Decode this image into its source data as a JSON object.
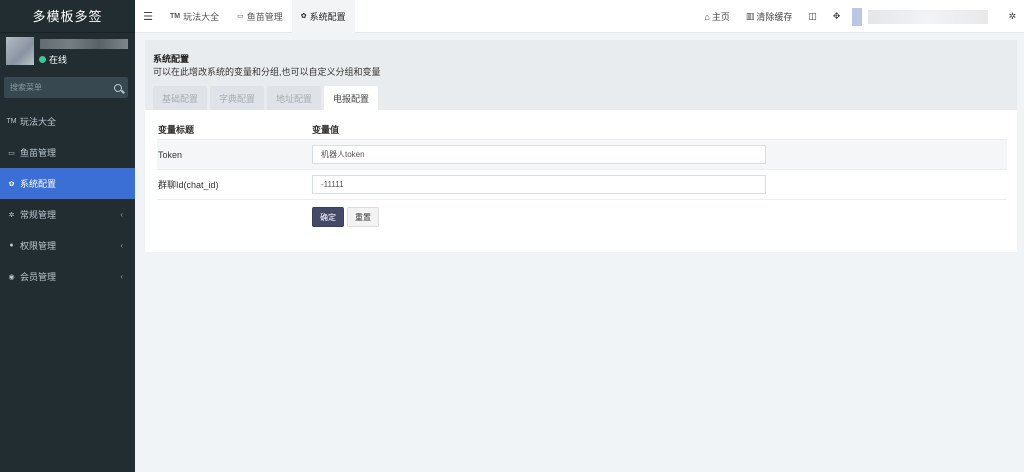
{
  "app": {
    "brand": "多模板多签"
  },
  "user": {
    "status": "在线"
  },
  "sidebar": {
    "search_placeholder": "搜索菜单",
    "items": [
      {
        "icon": "TM",
        "label": "玩法大全",
        "active": false,
        "has_children": false
      },
      {
        "icon": "gamepad",
        "label": "鱼苗管理",
        "active": false,
        "has_children": false
      },
      {
        "icon": "gear",
        "label": "系统配置",
        "active": true,
        "has_children": false
      },
      {
        "icon": "cogs",
        "label": "常规管理",
        "active": false,
        "has_children": true
      },
      {
        "icon": "users",
        "label": "权限管理",
        "active": false,
        "has_children": true
      },
      {
        "icon": "user-circle",
        "label": "会员管理",
        "active": false,
        "has_children": true
      }
    ]
  },
  "topnav": {
    "tabs": [
      {
        "icon": "TM",
        "label": "玩法大全",
        "active": false
      },
      {
        "icon": "gamepad",
        "label": "鱼苗管理",
        "active": false
      },
      {
        "icon": "gear",
        "label": "系统配置",
        "active": true
      }
    ],
    "home_label": "主页",
    "clear_cache_label": "清除缓存"
  },
  "panel": {
    "title": "系统配置",
    "description": "可以在此增改系统的变量和分组,也可以自定义分组和变量",
    "subtabs": [
      "基础配置",
      "字典配置",
      "地址配置",
      "电报配置"
    ],
    "active_subtab": 3,
    "table": {
      "col_title": "变量标题",
      "col_value": "变量值",
      "rows": [
        {
          "label": "Token",
          "value": "机器人token"
        },
        {
          "label": "群聊Id(chat_id)",
          "value": "-11111"
        }
      ]
    },
    "buttons": {
      "confirm": "确定",
      "reset": "重置"
    }
  },
  "colors": {
    "sidebar_bg": "#222d32",
    "active_menu": "#3c6fd6",
    "primary_button": "#444a66",
    "online_dot": "#33cc99"
  }
}
